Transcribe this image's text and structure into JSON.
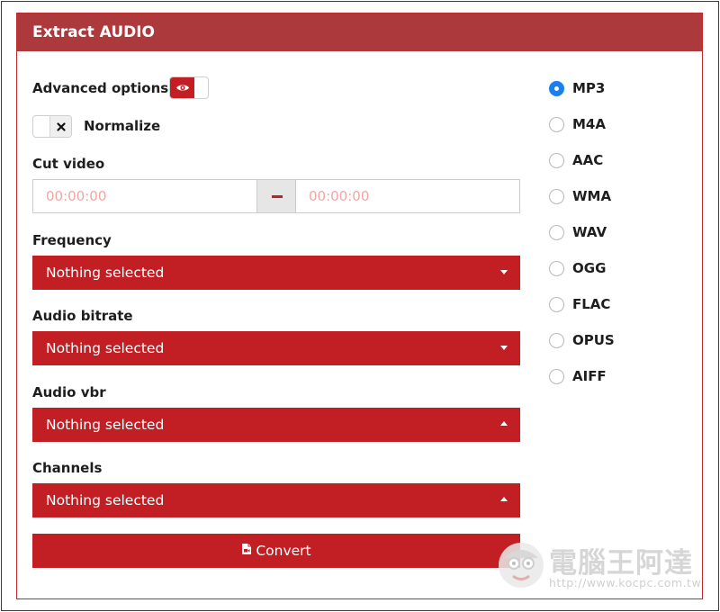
{
  "panel": {
    "title": "Extract AUDIO"
  },
  "advanced": {
    "label": "Advanced options:",
    "icon": "eye-icon",
    "state": "on"
  },
  "normalize": {
    "label": "Normalize",
    "icon": "close-icon",
    "state": "off"
  },
  "cut_video": {
    "label": "Cut video",
    "start_placeholder": "00:00:00",
    "end_placeholder": "00:00:00",
    "separator_icon": "minus-icon"
  },
  "frequency": {
    "label": "Frequency",
    "value": "Nothing selected"
  },
  "audio_bitrate": {
    "label": "Audio bitrate",
    "value": "Nothing selected"
  },
  "audio_vbr": {
    "label": "Audio vbr",
    "value": "Nothing selected"
  },
  "channels": {
    "label": "Channels",
    "value": "Nothing selected"
  },
  "convert": {
    "label": "Convert",
    "icon": "file-icon"
  },
  "formats": {
    "selected": "MP3",
    "options": [
      "MP3",
      "M4A",
      "AAC",
      "WMA",
      "WAV",
      "OGG",
      "FLAC",
      "OPUS",
      "AIFF"
    ]
  },
  "watermark": {
    "text": "電腦王阿達",
    "url": "http://www.kocpc.com.tw"
  },
  "colors": {
    "accent": "#c21f25",
    "header": "#ac393c",
    "radio_checked": "#1a7ff0"
  }
}
